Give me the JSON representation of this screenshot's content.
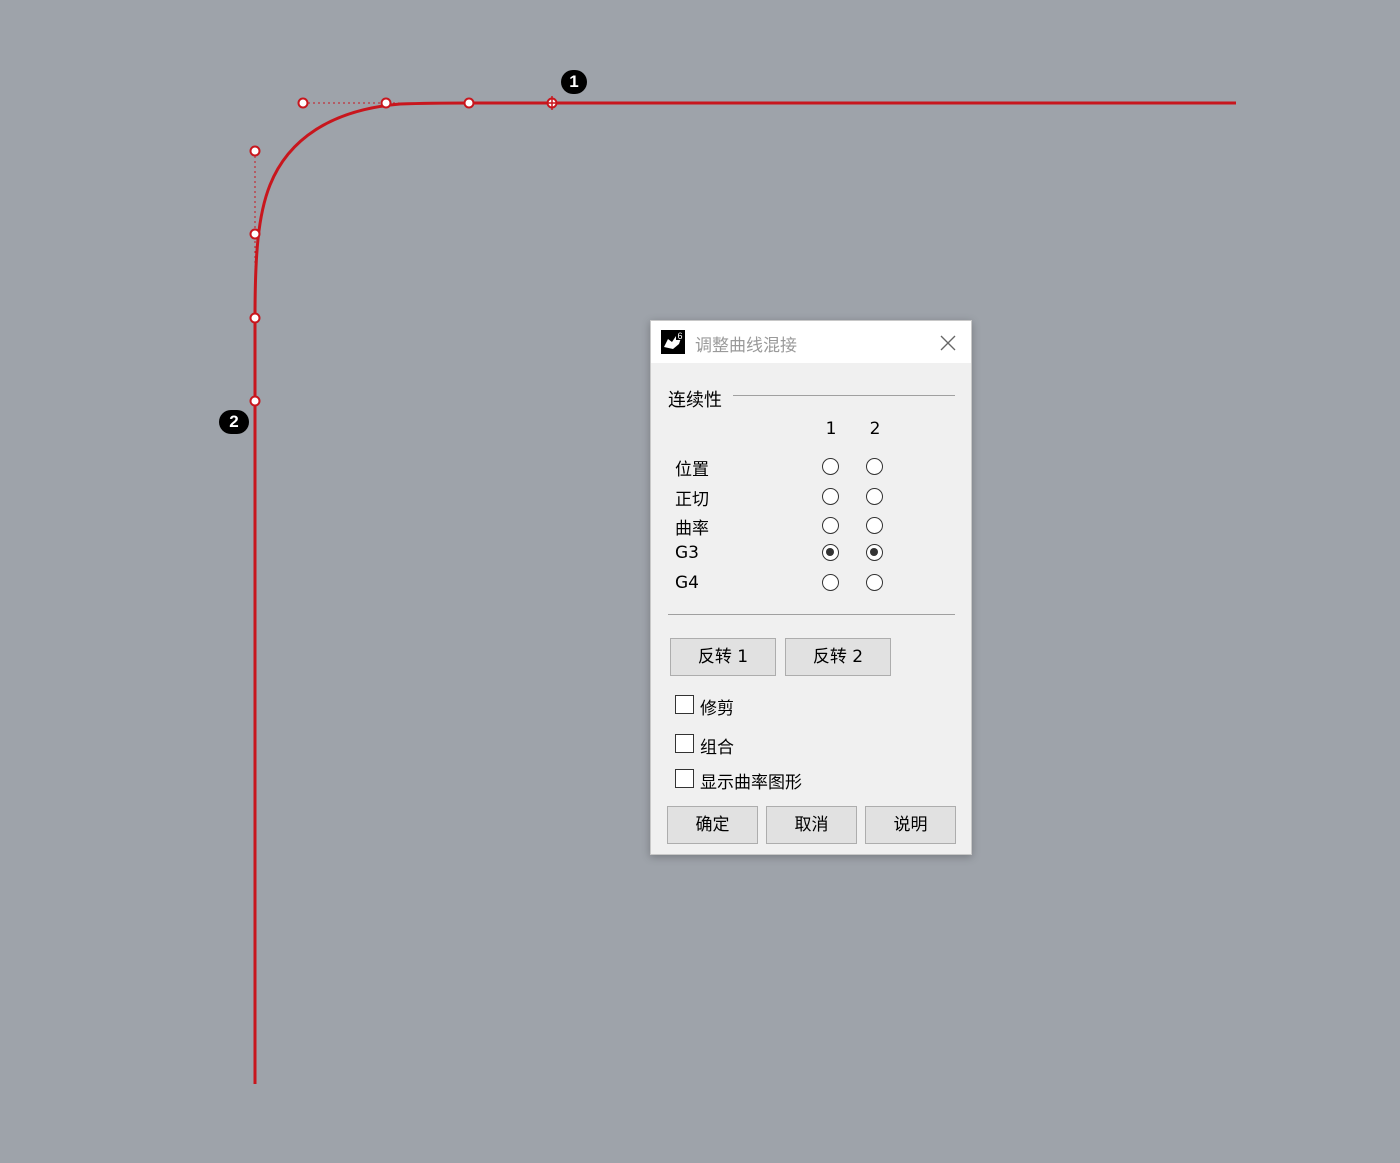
{
  "viewport": {
    "curve_color": "#c8161d",
    "markers": [
      "1",
      "2"
    ]
  },
  "dialog": {
    "icon": "rhino-6-app-icon",
    "title": "调整曲线混接",
    "close_icon": "close-icon",
    "continuity": {
      "group_label": "连续性",
      "columns": [
        "1",
        "2"
      ],
      "rows": [
        {
          "label": "位置",
          "end1": false,
          "end2": false
        },
        {
          "label": "正切",
          "end1": false,
          "end2": false
        },
        {
          "label": "曲率",
          "end1": false,
          "end2": false
        },
        {
          "label": "G3",
          "end1": true,
          "end2": true
        },
        {
          "label": "G4",
          "end1": false,
          "end2": false
        }
      ]
    },
    "reverse1": "反转 1",
    "reverse2": "反转 2",
    "options": [
      {
        "label": "修剪",
        "checked": false
      },
      {
        "label": "组合",
        "checked": false
      },
      {
        "label": "显示曲率图形",
        "checked": false
      }
    ],
    "ok": "确定",
    "cancel": "取消",
    "help": "说明"
  }
}
